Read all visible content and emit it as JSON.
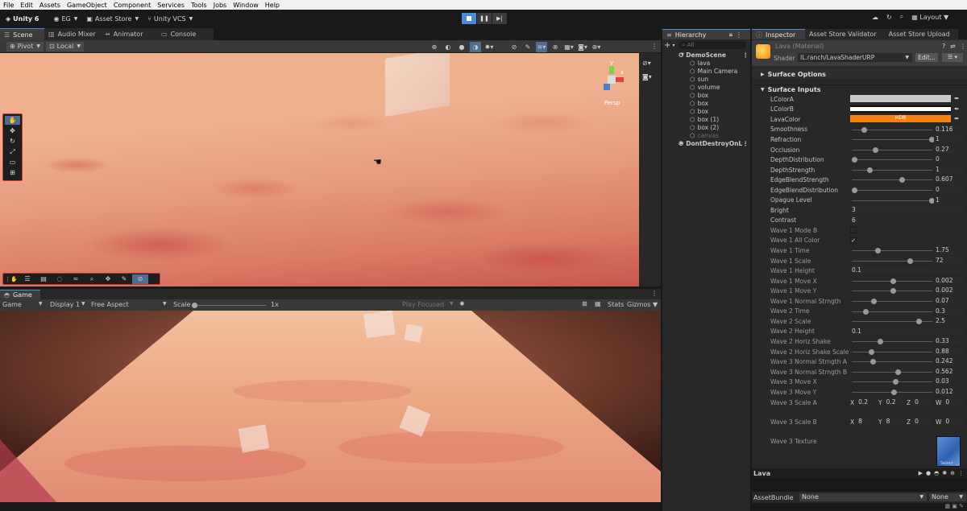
{
  "menu": [
    "File",
    "Edit",
    "Assets",
    "GameObject",
    "Component",
    "Services",
    "Tools",
    "Jobs",
    "Window",
    "Help"
  ],
  "toolbar": {
    "unity_version": "Unity 6",
    "account": "EG",
    "asset_store": "Asset Store",
    "vcs": "Unity VCS",
    "layout": "Layout",
    "play_icon": "stop-square-icon",
    "pause_icon": "pause-icon",
    "step_icon": "step-icon"
  },
  "scene_tabs": [
    {
      "label": "Scene",
      "icon": "scene-icon"
    },
    {
      "label": "Audio Mixer",
      "icon": "audio-mixer-icon"
    },
    {
      "label": "Animator",
      "icon": "animator-icon"
    },
    {
      "label": "Console",
      "icon": "console-icon"
    }
  ],
  "scene_toolbar": {
    "pivot": "Pivot",
    "local": "Local"
  },
  "gizmo": {
    "axis_y": "y",
    "axis_x": "x",
    "view": "Persp"
  },
  "game_tab": {
    "label": "Game"
  },
  "game_toolbar": {
    "mode": "Game",
    "display": "Display 1",
    "aspect": "Free Aspect",
    "scale_label": "Scale",
    "scale_value": "1x",
    "scale_fraction": 0.0,
    "play_focused": "Play Focused",
    "stats": "Stats",
    "gizmos": "Gizmos"
  },
  "hierarchy": {
    "title": "Hierarchy",
    "search_placeholder": "All",
    "items": [
      {
        "label": "DemoScene",
        "level": 0,
        "scene": true
      },
      {
        "label": "lava",
        "level": 1
      },
      {
        "label": "Main Camera",
        "level": 1
      },
      {
        "label": "sun",
        "level": 1
      },
      {
        "label": "volume",
        "level": 1
      },
      {
        "label": "box",
        "level": 1
      },
      {
        "label": "box",
        "level": 1
      },
      {
        "label": "box",
        "level": 1
      },
      {
        "label": "box (1)",
        "level": 1
      },
      {
        "label": "box (2)",
        "level": 1
      },
      {
        "label": "canvas",
        "level": 1,
        "dim": true
      },
      {
        "label": "DontDestroyOnL",
        "level": 0,
        "scene": true
      }
    ]
  },
  "inspector": {
    "tabs": [
      "Inspector",
      "Asset Store Validator",
      "Asset Store Upload"
    ],
    "material_name": "Lava (Material)",
    "shader_label": "Shader",
    "shader_value": "IL.ranch/LavaShaderURP",
    "edit_button": "Edit...",
    "surface_options": "Surface Options",
    "surface_inputs": "Surface Inputs",
    "properties": [
      {
        "label": "LColorA",
        "kind": "color",
        "color": "#c8c8c8"
      },
      {
        "label": "LColorB",
        "kind": "color",
        "color": "#ffffff"
      },
      {
        "label": "LavaColor",
        "kind": "color",
        "color": "#f7820f",
        "hdr": "HDR"
      },
      {
        "label": "Smoothness",
        "kind": "slider",
        "value": "0.116",
        "frac": 0.12
      },
      {
        "label": "Refraction",
        "kind": "slider",
        "value": "1",
        "frac": 1.0
      },
      {
        "label": "Occlusion",
        "kind": "slider",
        "value": "0.27",
        "frac": 0.27
      },
      {
        "label": "DepthDistribution",
        "kind": "slider",
        "value": "0",
        "frac": 0.0
      },
      {
        "label": "DepthStrength",
        "kind": "slider",
        "value": "1",
        "frac": 0.2
      },
      {
        "label": "EdgeBlendStrength",
        "kind": "slider",
        "value": "0.607",
        "frac": 0.61
      },
      {
        "label": "EdgeBlendDistribution",
        "kind": "slider",
        "value": "0",
        "frac": 0.0
      },
      {
        "label": "Opague Level",
        "kind": "slider",
        "value": "1",
        "frac": 1.0
      },
      {
        "label": "Bright",
        "kind": "field",
        "value": "3"
      },
      {
        "label": "Contrast",
        "kind": "field",
        "value": "6"
      },
      {
        "label": "Wave 1 Mode B",
        "kind": "check",
        "value": ""
      },
      {
        "label": "Wave 1 All Color",
        "kind": "check",
        "value": "✓"
      },
      {
        "label": "Wave 1 Time",
        "kind": "slider",
        "value": "1.75",
        "frac": 0.3
      },
      {
        "label": "Wave 1 Scale",
        "kind": "slider",
        "value": "72",
        "frac": 0.72
      },
      {
        "label": "Wave 1 Height",
        "kind": "field",
        "value": "0.1"
      },
      {
        "label": "Wave 1 Move X",
        "kind": "slider",
        "value": "0.002",
        "frac": 0.5
      },
      {
        "label": "Wave 1 Move Y",
        "kind": "slider",
        "value": "0.002",
        "frac": 0.5
      },
      {
        "label": "Wave 1 Normal Strngth",
        "kind": "slider",
        "value": "0.07",
        "frac": 0.25
      },
      {
        "label": "Wave 2 Time",
        "kind": "slider",
        "value": "0.3",
        "frac": 0.15
      },
      {
        "label": "Wave 2 Scale",
        "kind": "slider",
        "value": "2.5",
        "frac": 0.83
      },
      {
        "label": "Wave 2 Height",
        "kind": "field",
        "value": "0.1"
      },
      {
        "label": "Wave 2 Horiz Shake",
        "kind": "slider",
        "value": "0.33",
        "frac": 0.33
      },
      {
        "label": "Wave 2 Horiz Shake Scale",
        "kind": "slider",
        "value": "0.88",
        "frac": 0.22
      },
      {
        "label": "Wave 3 Normal Strngth A",
        "kind": "slider",
        "value": "0.242",
        "frac": 0.24
      },
      {
        "label": "Wave 3 Normal Strngth B",
        "kind": "slider",
        "value": "0.562",
        "frac": 0.56
      },
      {
        "label": "Wave 3 Move X",
        "kind": "slider",
        "value": "0.03",
        "frac": 0.53
      },
      {
        "label": "Wave 3 Move Y",
        "kind": "slider",
        "value": "0.012",
        "frac": 0.51
      }
    ],
    "wave3_scale_a": {
      "label": "Wave 3 Scale A",
      "x": "0.2",
      "y": "0.2",
      "z": "0",
      "w": "0"
    },
    "wave3_scale_b": {
      "label": "Wave 3 Scale B",
      "x": "8",
      "y": "8",
      "z": "0",
      "w": "0"
    },
    "wave3_texture": {
      "label": "Wave 3 Texture",
      "select": "Select"
    },
    "preview_title": "Lava",
    "asset_bundle_label": "AssetBundle",
    "asset_bundle_value": "None",
    "asset_bundle_variant": "None"
  }
}
